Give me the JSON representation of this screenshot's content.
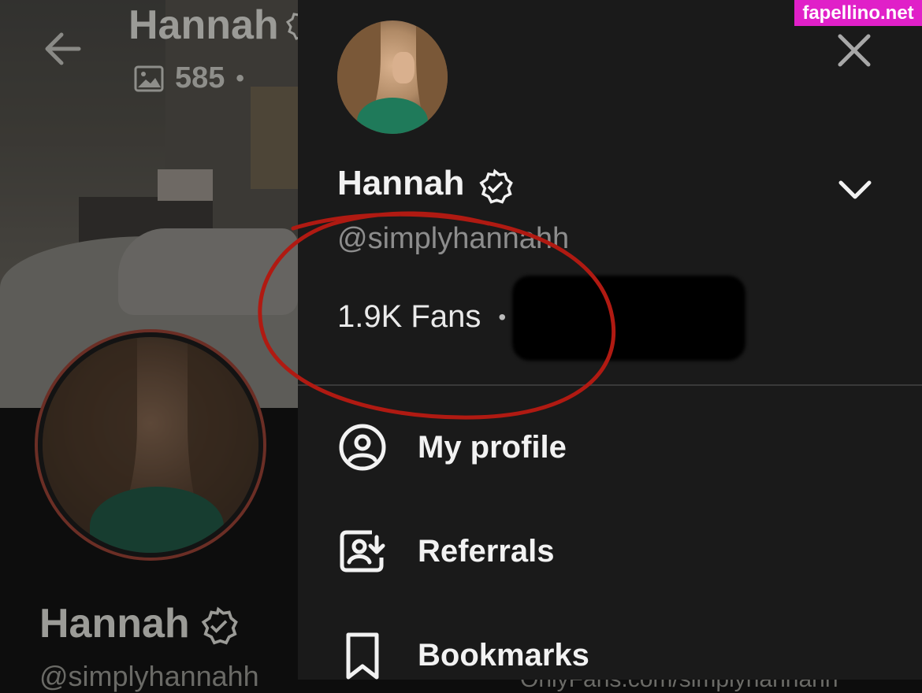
{
  "background_page": {
    "title": "Hannah",
    "media_count": "585",
    "stats_separator": "•",
    "name": "Hannah",
    "handle": "@simplyhannahh",
    "url_fragment": "OnlyFans.com/simplyhannahh"
  },
  "drawer": {
    "user": {
      "name": "Hannah",
      "handle": "@simplyhannahh",
      "fans": "1.9K Fans",
      "separator": "•"
    },
    "menu": [
      {
        "label": "My profile",
        "icon": "user-circle-icon"
      },
      {
        "label": "Referrals",
        "icon": "referrals-icon"
      },
      {
        "label": "Bookmarks",
        "icon": "bookmark-icon"
      }
    ]
  },
  "watermark": "fapellino.net",
  "colors": {
    "drawer_bg": "#1a1a1a",
    "text_primary": "#f2f2f2",
    "text_secondary": "#8d8d8d",
    "annotation": "#b01a12",
    "watermark_bg": "#e020c8"
  }
}
